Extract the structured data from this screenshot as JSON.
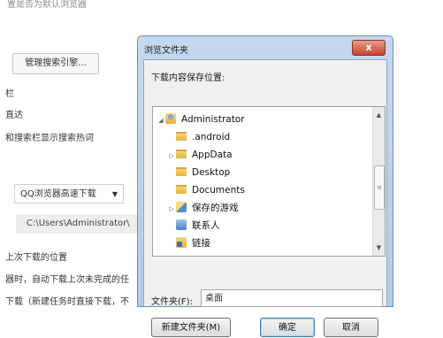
{
  "background": {
    "top_text": "置是否为默认浏览器",
    "manage_search_button": "管理搜索引擎...",
    "line_bar": "栏",
    "line_direct": "直达",
    "line_hot": "和搜索栏显示搜索热词",
    "download_tool_select": "QQ浏览器高速下载",
    "download_path": "C:\\Users\\Administrator\\",
    "last_location": "上次下载的位置",
    "resume_text": "器时，自动下载上次未完成的任",
    "new_task_text": "下载（新建任务时直接下载，不"
  },
  "dialog": {
    "title": "浏览文件夹",
    "close_symbol": "x",
    "prompt": "下载内容保存位置:",
    "tree": [
      {
        "label": "Administrator",
        "icon": "user-folder-icon",
        "expander": "◢"
      },
      {
        "label": ".android",
        "icon": "folder-icon",
        "expander": ""
      },
      {
        "label": "AppData",
        "icon": "folder-icon",
        "expander": "▷"
      },
      {
        "label": "Desktop",
        "icon": "folder-icon",
        "expander": ""
      },
      {
        "label": "Documents",
        "icon": "folder-icon",
        "expander": ""
      },
      {
        "label": "保存的游戏",
        "icon": "saved-games-icon",
        "expander": "▷"
      },
      {
        "label": "联系人",
        "icon": "contacts-icon",
        "expander": ""
      },
      {
        "label": "链接",
        "icon": "links-icon",
        "expander": ""
      }
    ],
    "folder_label": "文件夹(F):",
    "folder_value": "桌面",
    "new_folder_button": "新建文件夹(M)",
    "ok_button": "确定",
    "cancel_button": "取消"
  }
}
